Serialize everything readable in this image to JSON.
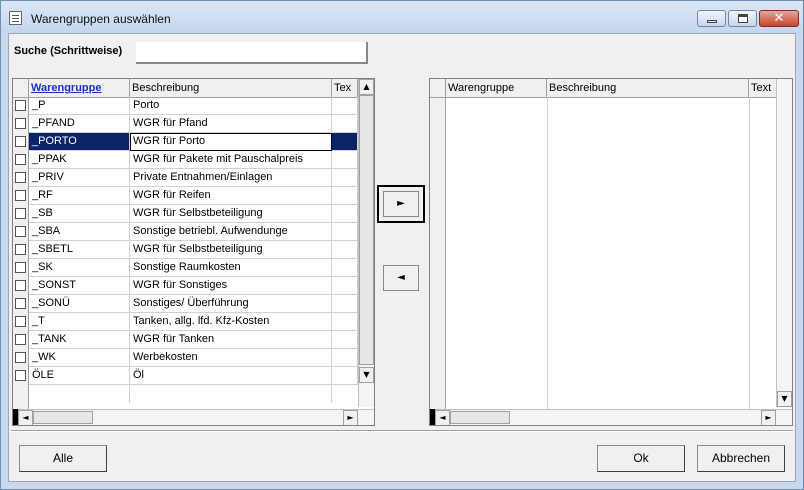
{
  "window": {
    "title": "Warengruppen auswählen",
    "minimize_glyph": "",
    "maximize_glyph": "",
    "close_glyph": "✕"
  },
  "search": {
    "label": "Suche (Schrittweise)",
    "value": "",
    "placeholder": ""
  },
  "left_grid": {
    "columns": [
      "Warengruppe",
      "Beschreibung",
      "Tex"
    ],
    "rows": [
      {
        "code": "_P",
        "desc": "Porto",
        "checked": false
      },
      {
        "code": "_PFAND",
        "desc": "WGR für Pfand",
        "checked": false
      },
      {
        "code": "_PORTO",
        "desc": "WGR für Porto",
        "checked": false,
        "selected": true
      },
      {
        "code": "_PPAK",
        "desc": "WGR für Pakete mit Pauschalpreis",
        "checked": false
      },
      {
        "code": "_PRIV",
        "desc": "Private Entnahmen/Einlagen",
        "checked": false
      },
      {
        "code": "_RF",
        "desc": "WGR für Reifen",
        "checked": false
      },
      {
        "code": "_SB",
        "desc": "WGR für Selbstbeteiligung",
        "checked": false
      },
      {
        "code": "_SBA",
        "desc": "Sonstige betriebl. Aufwendunge",
        "checked": false
      },
      {
        "code": "_SBETL",
        "desc": "WGR für Selbstbeteiligung",
        "checked": false
      },
      {
        "code": "_SK",
        "desc": "Sonstige Raumkosten",
        "checked": false
      },
      {
        "code": "_SONST",
        "desc": "WGR für Sonstiges",
        "checked": false
      },
      {
        "code": "_SONÜ",
        "desc": "Sonstiges/ Überführung",
        "checked": false
      },
      {
        "code": "_T",
        "desc": "Tanken,  allg. lfd. Kfz-Kosten",
        "checked": false
      },
      {
        "code": "_TANK",
        "desc": "WGR für Tanken",
        "checked": false
      },
      {
        "code": "_WK",
        "desc": "Werbekosten",
        "checked": false
      },
      {
        "code": "ÖLE",
        "desc": "Öl",
        "checked": false
      }
    ]
  },
  "right_grid": {
    "columns": [
      "Warengruppe",
      "Beschreibung",
      "Text"
    ],
    "rows": []
  },
  "scroll": {
    "up": "▲",
    "down": "▼",
    "left": "◄",
    "right": "►"
  },
  "move": {
    "add_glyph": "►",
    "remove_glyph": "◄"
  },
  "buttons": {
    "all": "Alle",
    "ok": "Ok",
    "cancel": "Abbrechen"
  },
  "colors": {
    "selection": "#0a246a",
    "header_link": "#1a31c8"
  }
}
